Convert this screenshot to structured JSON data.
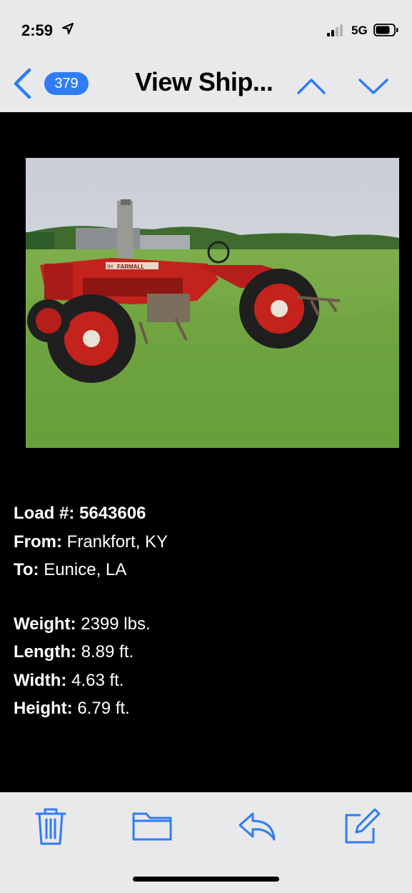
{
  "status_bar": {
    "time": "2:59",
    "location_icon": "location-arrow-icon",
    "network": "5G",
    "signal_icon": "cellular-signal-icon",
    "battery_icon": "battery-icon"
  },
  "nav": {
    "back_icon": "chevron-left-icon",
    "unread_count": "379",
    "title": "View Ship...",
    "prev_icon": "chevron-up-icon",
    "next_icon": "chevron-down-icon",
    "accent_color": "#2f7cf6"
  },
  "photo": {
    "icon": "tractor-photo",
    "decal_logo": "IH",
    "decal_text": "FARMALL"
  },
  "shipment": {
    "load_label": "Load #:",
    "load_value": "5643606",
    "from_label": "From:",
    "from_value": "Frankfort, KY",
    "to_label": "To:",
    "to_value": "Eunice, LA",
    "weight_label": "Weight:",
    "weight_value": "2399 lbs.",
    "length_label": "Length:",
    "length_value": "8.89 ft.",
    "width_label": "Width:",
    "width_value": "4.63 ft.",
    "height_label": "Height:",
    "height_value": "6.79 ft."
  },
  "toolbar": {
    "trash_icon": "trash-icon",
    "folder_icon": "folder-icon",
    "reply_icon": "reply-icon",
    "compose_icon": "compose-icon"
  }
}
